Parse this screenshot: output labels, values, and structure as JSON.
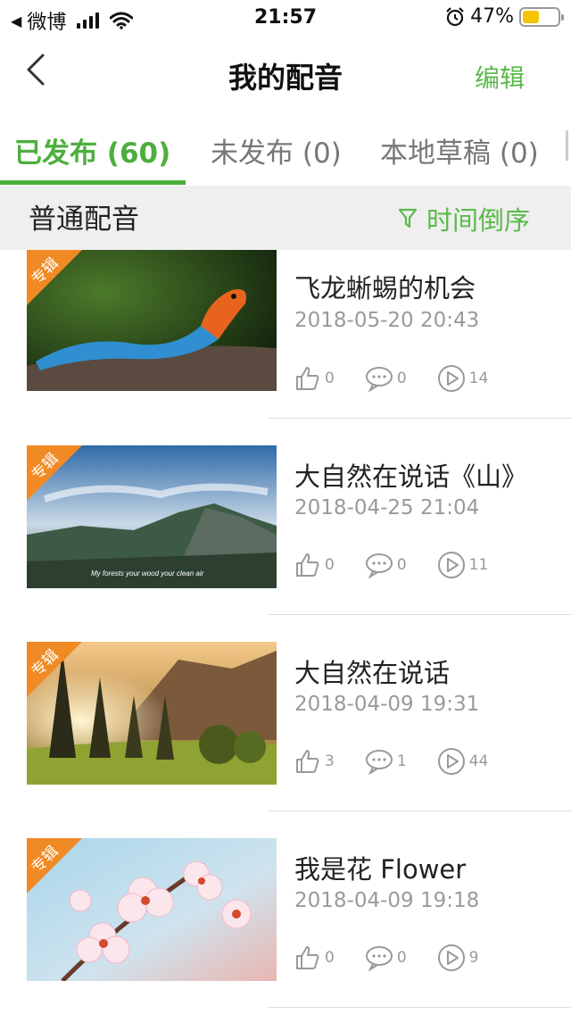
{
  "status_bar": {
    "back_app": "微博",
    "time": "21:57",
    "battery": "47%",
    "battery_level": 0.47
  },
  "nav": {
    "title": "我的配音",
    "edit_label": "编辑"
  },
  "tabs": [
    {
      "label": "已发布 (60)",
      "active": true
    },
    {
      "label": "未发布 (0)",
      "active": false
    },
    {
      "label": "本地草稿 (0)",
      "active": false
    },
    {
      "label": "",
      "active": false
    }
  ],
  "filter": {
    "title": "普通配音",
    "sort_label": "时间倒序"
  },
  "colors": {
    "accent": "#4caf3c",
    "badge": "#f08a24",
    "meta": "#9a9a9a"
  },
  "badge_label": "专辑",
  "items": [
    {
      "title": "飞龙蜥蜴的机会",
      "date": "2018-05-20 20:43",
      "likes": "0",
      "comments": "0",
      "plays": "14",
      "thumb": "lizard"
    },
    {
      "title": "大自然在说话《山》",
      "date": "2018-04-25 21:04",
      "likes": "0",
      "comments": "0",
      "plays": "11",
      "thumb": "mountains",
      "caption": "My forests your wood your clean air"
    },
    {
      "title": "大自然在说话",
      "date": "2018-04-09 19:31",
      "likes": "3",
      "comments": "1",
      "plays": "44",
      "thumb": "forest"
    },
    {
      "title": "我是花 Flower",
      "date": "2018-04-09 19:18",
      "likes": "0",
      "comments": "0",
      "plays": "9",
      "thumb": "blossom"
    }
  ]
}
